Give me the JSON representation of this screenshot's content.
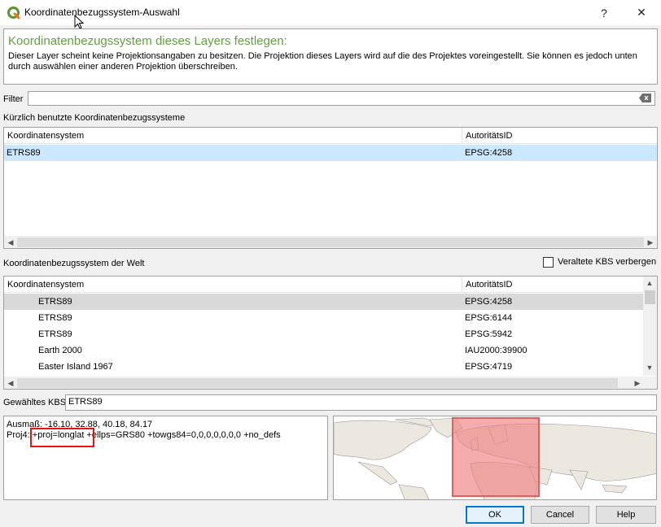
{
  "window": {
    "title": "Koordinatenbezugssystem-Auswahl",
    "help_label": "?",
    "close_label": "✕"
  },
  "info": {
    "heading": "Koordinatenbezugssystem dieses Layers festlegen:",
    "text": "Dieser Layer scheint keine Projektionsangaben zu besitzen. Die Projektion dieses Layers wird auf die des Projektes voreingestellt. Sie können es jedoch unten durch auswählen einer anderen Projektion überschreiben."
  },
  "filter": {
    "label": "Filter",
    "value": ""
  },
  "recent": {
    "label": "Kürzlich benutzte Koordinatenbezugssysteme",
    "columns": [
      "Koordinatensystem",
      "AutoritätsID"
    ],
    "rows": [
      {
        "name": "ETRS89",
        "id": "EPSG:4258"
      }
    ]
  },
  "world": {
    "label": "Koordinatenbezugssystem der Welt",
    "hide_deprecated_label": "Veraltete KBS verbergen",
    "columns": [
      "Koordinatensystem",
      "AutoritätsID"
    ],
    "rows": [
      {
        "name": "ETRS89",
        "id": "EPSG:4258"
      },
      {
        "name": "ETRS89",
        "id": "EPSG:6144"
      },
      {
        "name": "ETRS89",
        "id": "EPSG:5942"
      },
      {
        "name": "Earth 2000",
        "id": "IAU2000:39900"
      },
      {
        "name": "Easter Island 1967",
        "id": "EPSG:4719"
      }
    ]
  },
  "selected": {
    "label": "Gewähltes KBS",
    "value": "ETRS89"
  },
  "details": {
    "extent": "Ausmaß: -16.10, 32.88, 40.18, 84.17",
    "proj4": "Proj4: +proj=longlat +ellps=GRS80 +towgs84=0,0,0,0,0,0,0 +no_defs"
  },
  "buttons": {
    "ok": "OK",
    "cancel": "Cancel",
    "help": "Help"
  },
  "colors": {
    "heading_green": "#61a141",
    "recent_selection": "#cce8ff",
    "world_selection": "#d9d9d9",
    "extent_fill": "#f08080",
    "highlight_box": "#ee1111",
    "primary_border": "#0078d7"
  }
}
